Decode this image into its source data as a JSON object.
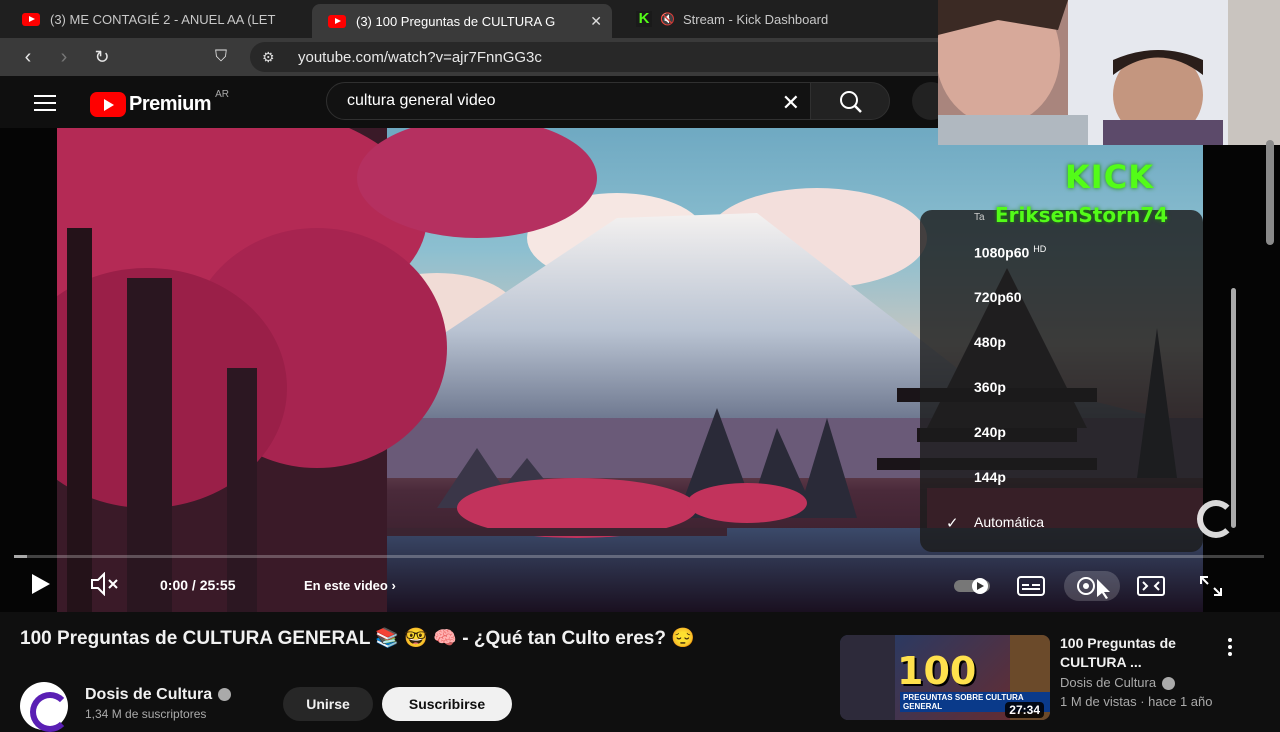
{
  "browser": {
    "tabs": [
      {
        "title": "(3) ME CONTAGIÉ 2 - ANUEL AA (LET",
        "active": false,
        "icon": "youtube-icon"
      },
      {
        "title": "(3) 100 Preguntas de CULTURA G",
        "active": true,
        "icon": "youtube-icon"
      },
      {
        "title": "Stream - Kick Dashboard",
        "active": false,
        "icon": "kick-icon"
      }
    ],
    "url": "youtube.com/watch?v=ajr7FnnGG3c",
    "tab_close_glyph": "✕",
    "kick_glyph": "K"
  },
  "youtube": {
    "brand": "Premium",
    "country": "AR",
    "search_value": "cultura general video"
  },
  "player": {
    "time": "0:00 / 25:55",
    "chapters_label": "En este video",
    "progress_fraction": 0.01,
    "quality_menu": {
      "header": "Ta",
      "options": [
        {
          "label": "1080p60",
          "badge": "HD"
        },
        {
          "label": "720p60",
          "badge": ""
        },
        {
          "label": "480p",
          "badge": ""
        },
        {
          "label": "360p",
          "badge": ""
        },
        {
          "label": "240p",
          "badge": ""
        },
        {
          "label": "144p",
          "badge": ""
        },
        {
          "label": "Automática",
          "badge": "",
          "selected": true
        }
      ]
    }
  },
  "overlay": {
    "kick_logo": "KICK",
    "streamer": "EriksenStorn74"
  },
  "video": {
    "title": "100 Preguntas de CULTURA GENERAL 📚 🤓 🧠 - ¿Qué tan Culto eres? 😔",
    "channel": "Dosis de Cultura",
    "subscribers": "1,34 M de suscriptores",
    "join_label": "Unirse",
    "subscribe_label": "Suscribirse"
  },
  "recommendation": {
    "title": "100 Preguntas de CULTURA ...",
    "channel": "Dosis de Cultura",
    "meta": "1 M de vistas · hace 1 año",
    "duration": "27:34",
    "thumb_big": "100",
    "thumb_sub": "PREGUNTAS SOBRE CULTURA GENERAL"
  },
  "colors": {
    "youtube_red": "#ff0000",
    "kick_green": "#53fc18",
    "background": "#0f0f0f"
  }
}
